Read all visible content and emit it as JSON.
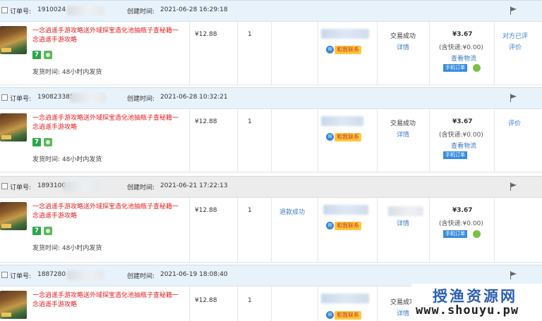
{
  "labels": {
    "order_no": "订单号:",
    "created": "创建时间:",
    "ship_time": "发货时间: 48小时内发货",
    "contact": "和我联系",
    "status": "交易成功",
    "detail": "详情",
    "logistics": "查看物流",
    "mobile_order": "手机订单",
    "refund": "退款成功"
  },
  "product_title": "一念逍遥手游攻略送外域探宝造化池抽瓶子查秘籍一念逍遥手游攻略",
  "orders": [
    {
      "order_no": "1910024",
      "created_at": "2021-06-28 16:29:18",
      "price": "¥12.88",
      "qty": "1",
      "amount": "¥3.67",
      "freight": "(含快递:¥0.00)",
      "eval": "对方已评",
      "eval2": "评价",
      "header_style": "blue"
    },
    {
      "order_no": "190823385",
      "created_at": "2021-06-28 10:32:21",
      "price": "¥12.88",
      "qty": "1",
      "amount": "¥3.67",
      "freight": "(含快递:¥0.00)",
      "eval": "评价",
      "header_style": "blue"
    },
    {
      "order_no": "1893100",
      "created_at": "2021-06-21 17:22:13",
      "price": "¥12.88",
      "qty": "1",
      "amount": "¥3.67",
      "freight": "(含快递:¥0.00)",
      "eval": "",
      "header_style": "gray"
    },
    {
      "order_no": "1887280",
      "created_at": "2021-06-19 18:08:40",
      "price": "¥12.88",
      "qty": "1",
      "header_style": "blue"
    }
  ],
  "watermark": {
    "cn": "授渔资源网",
    "url": "www.shouyu.pw"
  },
  "colors": {
    "link": "#3a7bc8",
    "title_red": "#e02020",
    "header_blue": "#e8f2fb",
    "header_gray": "#ececec"
  }
}
